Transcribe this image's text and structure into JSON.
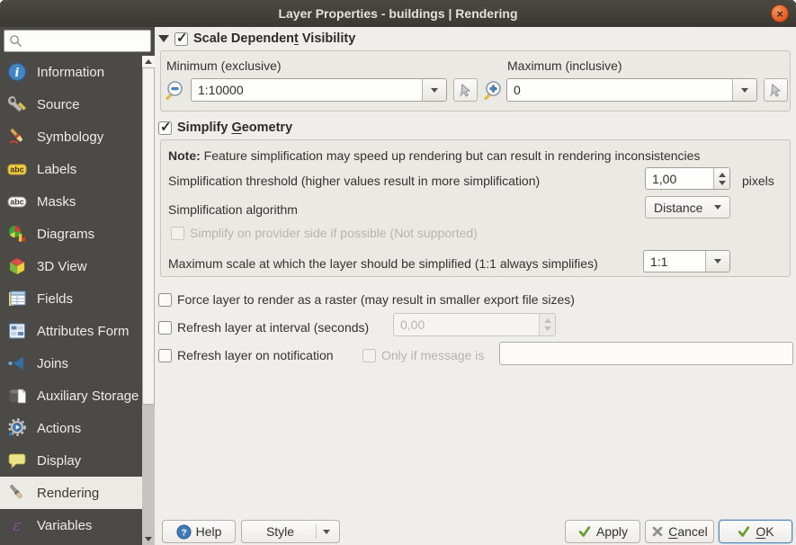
{
  "window": {
    "title": "Layer Properties - buildings | Rendering",
    "close_glyph": "×"
  },
  "colors": {
    "titlebar": "#3f3e38",
    "close_button": "#e2561f",
    "sidebar_bg": "#4b4a46",
    "selected_item_bg": "#eceae4",
    "dialog_bg": "#f0eeea",
    "check_green": "#64a030",
    "ok_focus_border": "#5d89b4"
  },
  "sidebar": {
    "search_placeholder": "",
    "items": [
      {
        "label": "Information",
        "icon": "info-icon"
      },
      {
        "label": "Source",
        "icon": "source-icon"
      },
      {
        "label": "Symbology",
        "icon": "symbology-icon"
      },
      {
        "label": "Labels",
        "icon": "labels-icon"
      },
      {
        "label": "Masks",
        "icon": "masks-icon"
      },
      {
        "label": "Diagrams",
        "icon": "diagrams-icon"
      },
      {
        "label": "3D View",
        "icon": "3d-view-icon"
      },
      {
        "label": "Fields",
        "icon": "fields-icon"
      },
      {
        "label": "Attributes Form",
        "icon": "attributes-form-icon"
      },
      {
        "label": "Joins",
        "icon": "joins-icon"
      },
      {
        "label": "Auxiliary Storage",
        "icon": "auxiliary-storage-icon"
      },
      {
        "label": "Actions",
        "icon": "actions-icon"
      },
      {
        "label": "Display",
        "icon": "display-icon"
      },
      {
        "label": "Rendering",
        "icon": "rendering-icon",
        "selected": true
      },
      {
        "label": "Variables",
        "icon": "variables-icon"
      }
    ]
  },
  "content": {
    "scale": {
      "title_pre": "Scale Dependen",
      "title_mn": "t",
      "title_post": " Visibility",
      "checked": true,
      "min_label": "Minimum (exclusive)",
      "min_value": "1:10000",
      "max_label": "Maximum (inclusive)",
      "max_value": "0"
    },
    "simplify": {
      "title_pre": "Simplify ",
      "title_mn": "G",
      "title_post": "eometry",
      "checked": true,
      "note_label": "Note:",
      "note_text": "Feature simplification may speed up rendering but can result in rendering inconsistencies",
      "threshold_label": "Simplification threshold (higher values result in more simplification)",
      "threshold_value": "1,00",
      "threshold_unit": "pixels",
      "algorithm_label": "Simplification algorithm",
      "algorithm_value": "Distance",
      "provider_label": "Simplify on provider side if possible (Not supported)",
      "maxscale_label": "Maximum scale at which the layer should be simplified (1:1 always simplifies)",
      "maxscale_value": "1:1"
    },
    "options": {
      "force_raster": "Force layer to render as a raster (may result in smaller export file sizes)",
      "refresh_interval": "Refresh layer at interval (seconds)",
      "refresh_interval_value": "0,00",
      "refresh_notification": "Refresh layer on notification",
      "only_if_message": "Only if message is",
      "message_value": ""
    }
  },
  "footer": {
    "help": "Help",
    "style": "Style",
    "apply": "Apply",
    "cancel_mn": "C",
    "cancel_post": "ancel",
    "ok_mn": "O",
    "ok_post": "K"
  }
}
